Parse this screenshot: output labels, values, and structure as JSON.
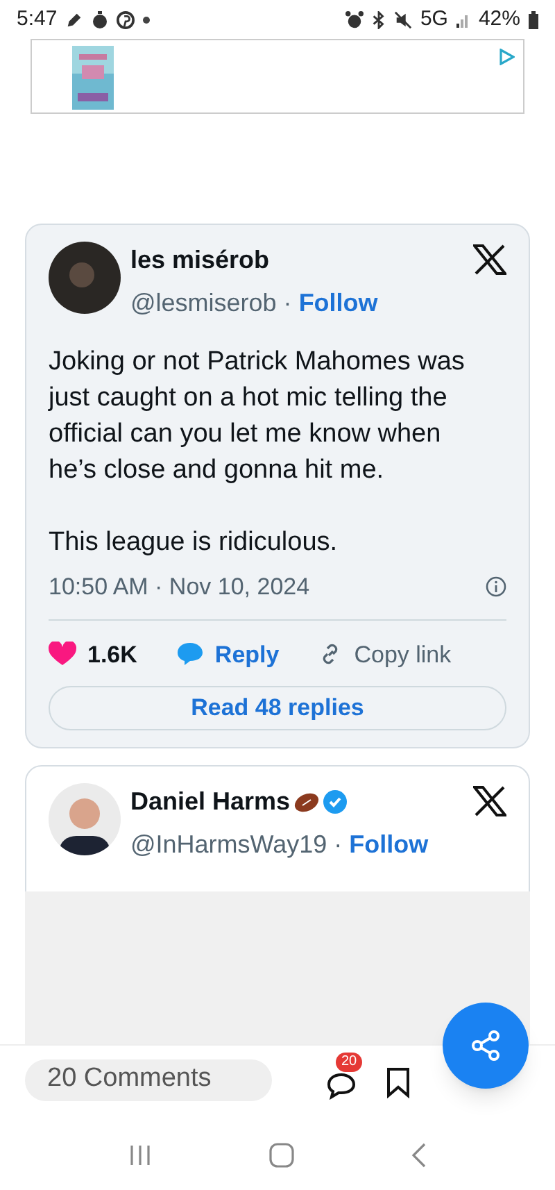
{
  "status_bar": {
    "time": "5:47",
    "network": "5G",
    "battery": "42%"
  },
  "tweets": [
    {
      "name": "les misérob",
      "verified": false,
      "emoji": false,
      "handle": "@lesmiserob ·",
      "follow": "Follow",
      "text": [
        "Joking or not Patrick Mahomes was just caught on a hot mic telling the official can you let me know when he’s close and gonna hit me.",
        "This league is ridiculous."
      ],
      "timestamp": "10:50 AM · Nov 10, 2024",
      "likes": "1.6K",
      "reply": "Reply",
      "copy_link": "Copy link",
      "read_replies": "Read 48 replies"
    },
    {
      "name": "Daniel Harms",
      "verified": true,
      "emoji": true,
      "handle": "@InHarmsWay19 ·",
      "follow": "Follow"
    }
  ],
  "bottom_bar": {
    "comments": "20 Comments",
    "badge": "20"
  }
}
